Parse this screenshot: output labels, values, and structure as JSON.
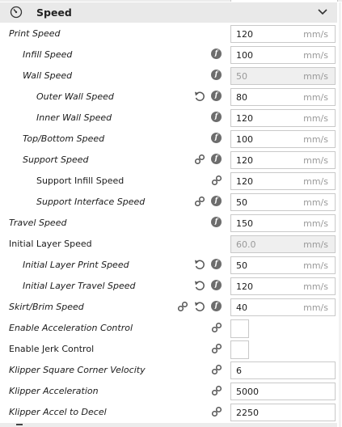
{
  "category": {
    "title": "Speed",
    "icon": "speedometer-icon"
  },
  "rows": [
    {
      "label": "Print Speed",
      "value": "120",
      "unit": "mm/s"
    },
    {
      "label": "Infill Speed",
      "value": "100",
      "unit": "mm/s"
    },
    {
      "label": "Wall Speed",
      "value": "50",
      "unit": "mm/s"
    },
    {
      "label": "Outer Wall Speed",
      "value": "80",
      "unit": "mm/s"
    },
    {
      "label": "Inner Wall Speed",
      "value": "120",
      "unit": "mm/s"
    },
    {
      "label": "Top/Bottom Speed",
      "value": "100",
      "unit": "mm/s"
    },
    {
      "label": "Support Speed",
      "value": "120",
      "unit": "mm/s"
    },
    {
      "label": "Support Infill Speed",
      "value": "120",
      "unit": "mm/s"
    },
    {
      "label": "Support Interface Speed",
      "value": "50",
      "unit": "mm/s"
    },
    {
      "label": "Travel Speed",
      "value": "150",
      "unit": "mm/s"
    },
    {
      "label": "Initial Layer Speed",
      "value": "60.0",
      "unit": "mm/s"
    },
    {
      "label": "Initial Layer Print Speed",
      "value": "50",
      "unit": "mm/s"
    },
    {
      "label": "Initial Layer Travel Speed",
      "value": "120",
      "unit": "mm/s"
    },
    {
      "label": "Skirt/Brim Speed",
      "value": "40",
      "unit": "mm/s"
    },
    {
      "label": "Enable Acceleration Control",
      "checked": false
    },
    {
      "label": "Enable Jerk Control",
      "checked": false
    },
    {
      "label": "Klipper Square Corner Velocity",
      "value": "6"
    },
    {
      "label": "Klipper Acceleration",
      "value": "5000"
    },
    {
      "label": "Klipper Accel to Decel",
      "value": "2250"
    }
  ]
}
